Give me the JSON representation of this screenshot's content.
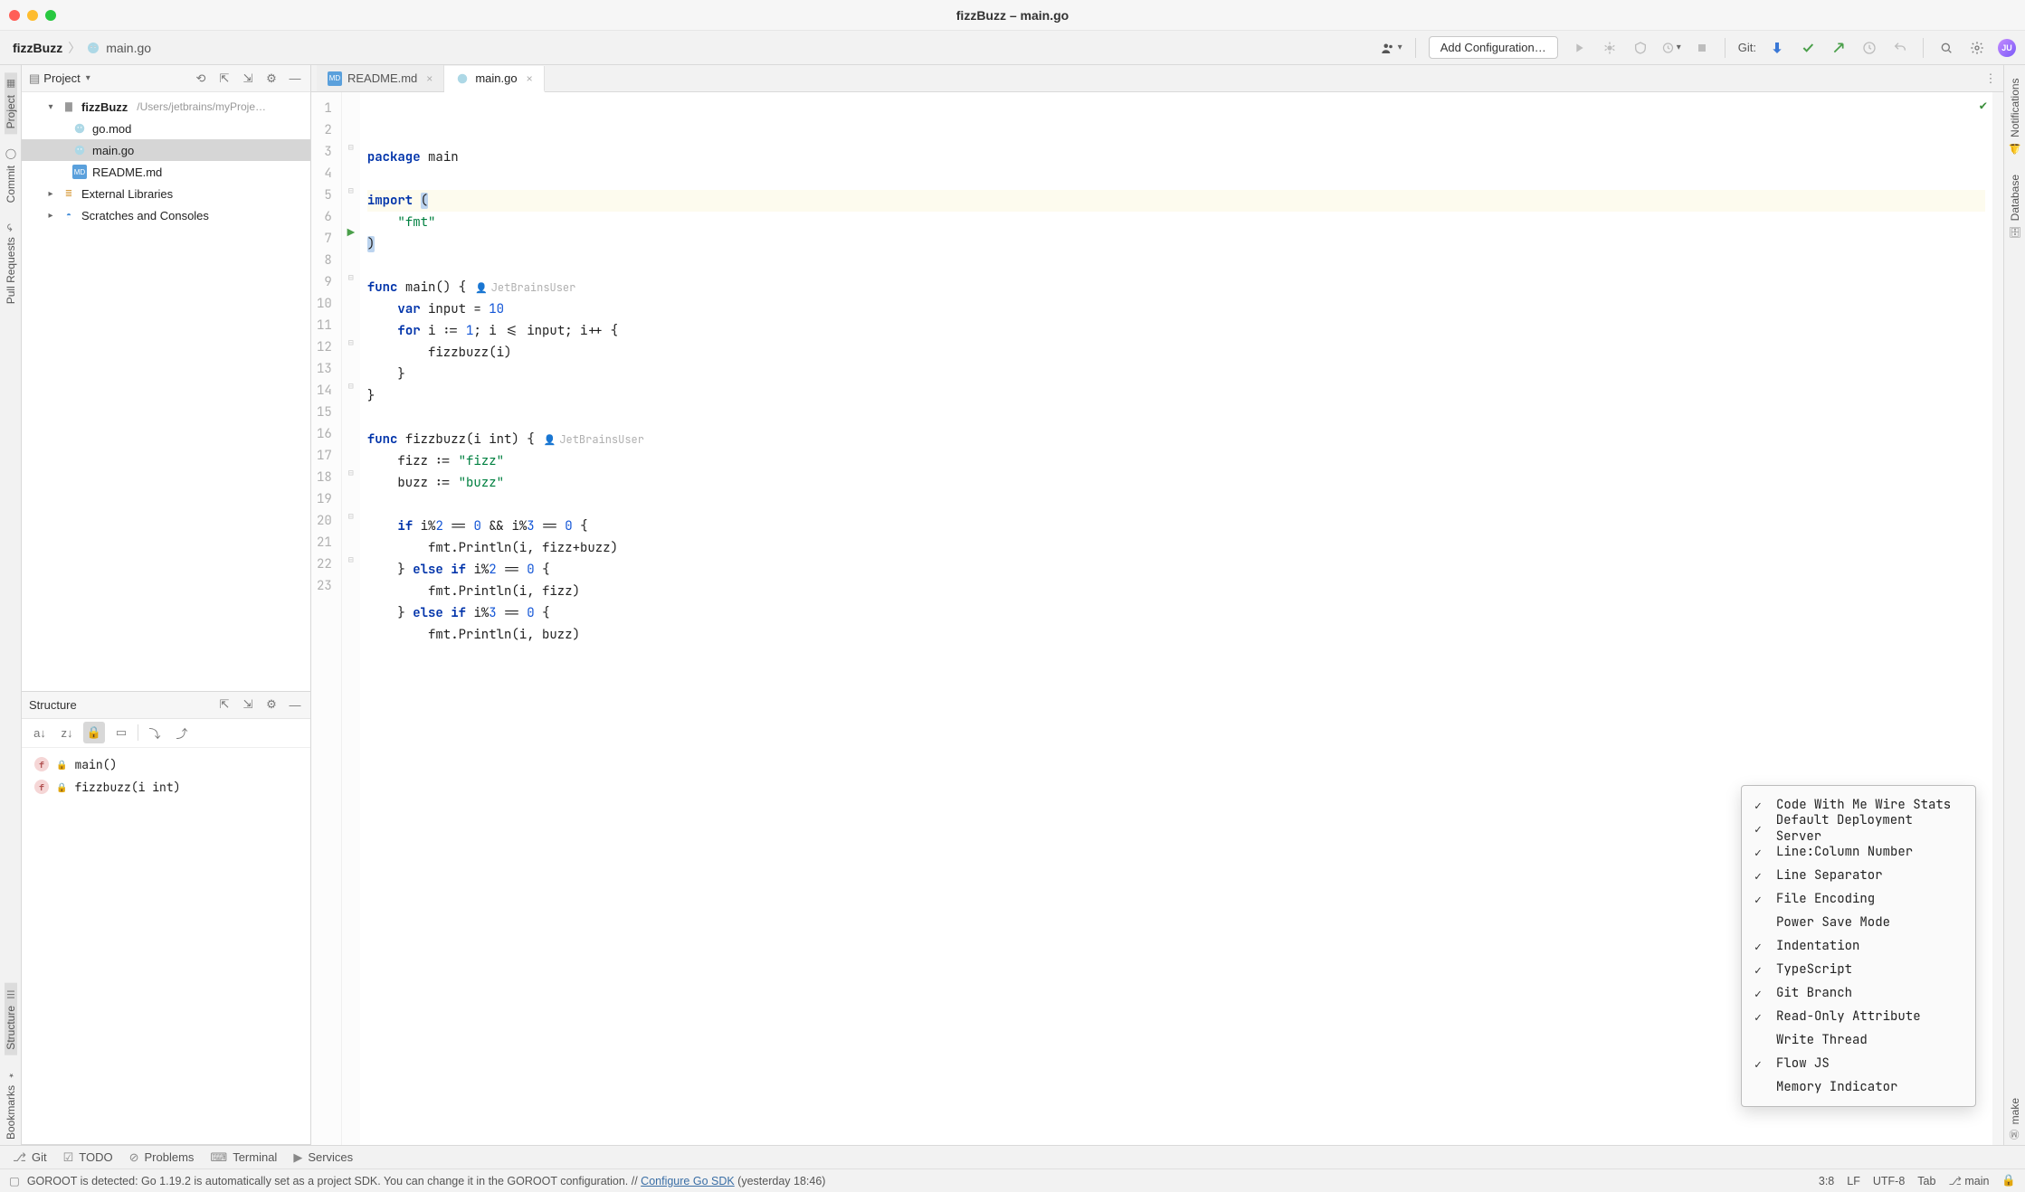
{
  "window": {
    "title": "fizzBuzz – main.go"
  },
  "breadcrumbs": {
    "project": "fizzBuzz",
    "file": "main.go"
  },
  "toolbar": {
    "add_configuration": "Add Configuration…",
    "git_label": "Git:",
    "avatar_initials": "JU"
  },
  "left_strip": {
    "project": "Project",
    "commit": "Commit",
    "pull_requests": "Pull Requests",
    "structure": "Structure",
    "bookmarks": "Bookmarks"
  },
  "right_strip": {
    "notifications": "Notifications",
    "database": "Database",
    "make": "make"
  },
  "project_panel": {
    "title": "Project",
    "root": {
      "name": "fizzBuzz",
      "path": "/Users/jetbrains/myProje…"
    },
    "files": [
      {
        "name": "go.mod",
        "icon": "go"
      },
      {
        "name": "main.go",
        "icon": "go",
        "selected": true
      },
      {
        "name": "README.md",
        "icon": "md"
      }
    ],
    "external_libraries": "External Libraries",
    "scratches": "Scratches and Consoles"
  },
  "structure_panel": {
    "title": "Structure",
    "items": [
      {
        "label": "main()"
      },
      {
        "label": "fizzbuzz(i int)"
      }
    ]
  },
  "tabs": [
    {
      "label": "README.md",
      "icon": "md",
      "active": false
    },
    {
      "label": "main.go",
      "icon": "go",
      "active": true
    }
  ],
  "code": {
    "code_lens_author": "JetBrainsUser",
    "lines": [
      {
        "n": 1,
        "text": "package main"
      },
      {
        "n": 2,
        "text": ""
      },
      {
        "n": 3,
        "text": "import (",
        "highlight": true
      },
      {
        "n": 4,
        "text": "    \"fmt\""
      },
      {
        "n": 5,
        "text": ")"
      },
      {
        "n": 6,
        "text": ""
      },
      {
        "n": 7,
        "text": "func main() {",
        "run": true,
        "lens": true
      },
      {
        "n": 8,
        "text": "    var input = 10"
      },
      {
        "n": 9,
        "text": "    for i := 1; i <= input; i++ {"
      },
      {
        "n": 10,
        "text": "        fizzbuzz(i)"
      },
      {
        "n": 11,
        "text": "    }"
      },
      {
        "n": 12,
        "text": "}"
      },
      {
        "n": 13,
        "text": ""
      },
      {
        "n": 14,
        "text": "func fizzbuzz(i int) {",
        "lens": true
      },
      {
        "n": 15,
        "text": "    fizz := \"fizz\""
      },
      {
        "n": 16,
        "text": "    buzz := \"buzz\""
      },
      {
        "n": 17,
        "text": ""
      },
      {
        "n": 18,
        "text": "    if i%2 == 0 && i%3 == 0 {"
      },
      {
        "n": 19,
        "text": "        fmt.Println(i, fizz+buzz)"
      },
      {
        "n": 20,
        "text": "    } else if i%2 == 0 {"
      },
      {
        "n": 21,
        "text": "        fmt.Println(i, fizz)"
      },
      {
        "n": 22,
        "text": "    } else if i%3 == 0 {"
      },
      {
        "n": 23,
        "text": "        fmt.Println(i, buzz)"
      }
    ]
  },
  "context_menu": {
    "items": [
      {
        "label": "Code With Me Wire Stats",
        "checked": true
      },
      {
        "label": "Default Deployment Server",
        "checked": true
      },
      {
        "label": "Line:Column Number",
        "checked": true
      },
      {
        "label": "Line Separator",
        "checked": true
      },
      {
        "label": "File Encoding",
        "checked": true
      },
      {
        "label": "Power Save Mode",
        "checked": false
      },
      {
        "label": "Indentation",
        "checked": true
      },
      {
        "label": "TypeScript",
        "checked": true
      },
      {
        "label": "Git Branch",
        "checked": true
      },
      {
        "label": "Read-Only Attribute",
        "checked": true
      },
      {
        "label": "Write Thread",
        "checked": false
      },
      {
        "label": "Flow JS",
        "checked": true
      },
      {
        "label": "Memory Indicator",
        "checked": false
      }
    ]
  },
  "bottom_tools": {
    "git": "Git",
    "todo": "TODO",
    "problems": "Problems",
    "terminal": "Terminal",
    "services": "Services"
  },
  "statusbar": {
    "msg_prefix": "GOROOT is detected: Go 1.19.2 is automatically set as a project SDK. You can change it in the GOROOT configuration. // ",
    "msg_link": "Configure Go SDK",
    "msg_suffix": " (yesterday 18:46)",
    "cursor": "3:8",
    "line_sep": "LF",
    "encoding": "UTF-8",
    "indent": "Tab",
    "branch": "main"
  }
}
